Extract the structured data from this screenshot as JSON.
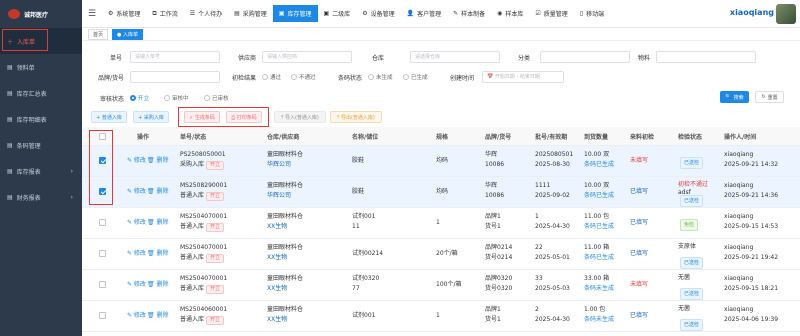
{
  "brand": {
    "name": "诚邦医疗"
  },
  "sidebar": {
    "items": [
      {
        "label": "入库单",
        "icon": "plus-icon",
        "active": true
      },
      {
        "label": "领料单",
        "icon": "document-icon"
      },
      {
        "label": "库存汇总表",
        "icon": "document-icon"
      },
      {
        "label": "库存明细表",
        "icon": "document-icon"
      },
      {
        "label": "条码管理",
        "icon": "document-icon"
      },
      {
        "label": "库存报表",
        "icon": "document-icon",
        "arrow": "›"
      },
      {
        "label": "财务报表",
        "icon": "document-icon",
        "arrow": "›"
      }
    ]
  },
  "topnav": {
    "items": [
      {
        "label": "系统管理",
        "icon": "gear-icon"
      },
      {
        "label": "工作流",
        "icon": "flow-icon"
      },
      {
        "label": "个人待办",
        "icon": "list-icon"
      },
      {
        "label": "采购管理",
        "icon": "doc-icon"
      },
      {
        "label": "库存管理",
        "icon": "box-icon",
        "active": true
      },
      {
        "label": "二级库",
        "icon": "box-icon"
      },
      {
        "label": "设备管理",
        "icon": "gear-icon"
      },
      {
        "label": "客户管理",
        "icon": "user-icon"
      },
      {
        "label": "样本制备",
        "icon": "edit-icon"
      },
      {
        "label": "样本库",
        "icon": "github-icon"
      },
      {
        "label": "质量管理",
        "icon": "check-icon"
      },
      {
        "label": "移动端",
        "icon": "mobile-icon"
      }
    ],
    "user": "xiaoqiang"
  },
  "tags": {
    "home": "首页",
    "active": "入库单"
  },
  "filter": {
    "labels": {
      "code": "单号",
      "supplier": "供应商",
      "warehouse": "仓库",
      "category": "分类",
      "material": "物料",
      "brand": "品牌/货号",
      "inspect": "初检结果",
      "barcode": "条码状态",
      "created": "创建时间",
      "audit": "审核状态"
    },
    "placeholders": {
      "code": "请输入单号",
      "supplier": "请输入供应商",
      "warehouse": "请选择仓库",
      "created_start": "开始日期",
      "created_end": "结束日期",
      "range_sep": "-"
    },
    "inspect_opts": [
      "通过",
      "不通过"
    ],
    "barcode_opts": [
      "未生成",
      "已生成"
    ],
    "audit_opts": [
      "开立",
      "审核中",
      "已审核"
    ]
  },
  "toolbar": {
    "new": "+ 普通入库",
    "purchase": "+ 采购入库",
    "gen": "✓ 生成条码",
    "print": "⎙ 打印条码",
    "import": "⤒ 导入(普通入库)",
    "import2": "⤒ 导出(普通入库)",
    "search": "搜索",
    "reset": "重置"
  },
  "table": {
    "headers": [
      "操作",
      "单号/状态",
      "仓库/供应商",
      "名称/储位",
      "规格",
      "品牌/货号",
      "批号/有效期",
      "到货数量",
      "来料初检",
      "检验状态",
      "操作人/时间"
    ],
    "actions": {
      "edit": "✎ 修改",
      "del": "🗑 删除"
    },
    "rows": [
      {
        "checked": true,
        "no": "PS2508050001",
        "type": "采购入库",
        "status": "开立",
        "wh": "童田眼材料仓",
        "sup": "华辉公司",
        "name": "胶鞋",
        "loc": "",
        "spec": "均码",
        "brand": "华辉",
        "code": "10086",
        "lot": "2025080501",
        "exp": "2025-08-30",
        "qty": "10.00 双",
        "bar": "条码已生成",
        "insp": "未填写",
        "insp_red": true,
        "check": "已送检",
        "check_green": false,
        "op": "xiaoqiang",
        "time": "2025-09-21 14:32"
      },
      {
        "checked": true,
        "no": "MS2508290001",
        "type": "普通入库",
        "status": "开立",
        "wh": "童田眼材料仓",
        "sup": "华辉公司",
        "name": "胶鞋",
        "loc": "",
        "spec": "均码",
        "brand": "华辉",
        "code": "10086",
        "lot": "1111",
        "exp": "2025-09-02",
        "qty": "10.00 双",
        "bar": "条码已生成",
        "insp": "已填写",
        "insp_red": false,
        "check": "已送检",
        "check_green": false,
        "check_pre": "初检不通过",
        "check_note": "adsf",
        "op": "xiaoqiang",
        "time": "2025-09-21 14:36"
      },
      {
        "checked": false,
        "no": "MS2504070001",
        "type": "普通入库",
        "status": "开立",
        "wh": "童田眼材料仓",
        "sup": "XX生物",
        "name": "试剂001",
        "loc": "11",
        "spec": "1",
        "brand": "品牌1",
        "code": "货号1",
        "lot": "1",
        "exp": "2025-04-30",
        "qty": "11.00 包",
        "bar": "条码已生成",
        "insp": "已填写",
        "insp_red": false,
        "check": "免检",
        "check_green": true,
        "op": "xiaoqiang",
        "time": "2025-09-15 14:53"
      },
      {
        "checked": false,
        "no": "MS2504070001",
        "type": "普通入库",
        "status": "开立",
        "wh": "童田眼材料仓",
        "sup": "XX生物",
        "name": "试剂00214",
        "loc": "",
        "spec": "20个/箱",
        "brand": "品牌0214",
        "code": "货号0214",
        "lot": "22",
        "exp": "2025-05-01",
        "qty": "11.00 箱",
        "bar": "条码已生成",
        "insp": "已填写",
        "insp_red": false,
        "check": "已送检",
        "check_green": false,
        "check_pre": "支原体",
        "op": "xiaoqiang",
        "time": "2025-09-21 19:42"
      },
      {
        "checked": false,
        "no": "MS2504070001",
        "type": "普通入库",
        "status": "开立",
        "wh": "童田眼材料仓",
        "sup": "XX生物",
        "name": "试剂0320",
        "loc": "77",
        "spec": "100个/箱",
        "brand": "品牌0320",
        "code": "货号0320",
        "lot": "33",
        "exp": "2025-05-03",
        "qty": "33.00 箱",
        "bar": "条码未生成",
        "insp": "未填写",
        "insp_red": true,
        "check": "已送检",
        "check_green": false,
        "check_pre": "无菌",
        "op": "xiaoqiang",
        "time": "2025-09-15 18:21"
      },
      {
        "checked": false,
        "no": "MS2504060001",
        "type": "普通入库",
        "status": "开立",
        "wh": "童田眼材料仓",
        "sup": "XX生物",
        "name": "试剂001",
        "loc": "",
        "spec": "1",
        "brand": "品牌1",
        "code": "货号1",
        "lot": "2",
        "exp": "2025-04-30",
        "qty": "1.00 包",
        "bar": "条码未生成",
        "insp": "已填写",
        "insp_red": false,
        "check": "已送检",
        "check_green": false,
        "check_pre": "无菌",
        "op": "xiaoqiang",
        "time": "2025-04-06 19:39"
      }
    ]
  },
  "colors": {
    "accent": "#1e88e5",
    "sidebar": "#2d3a4b",
    "danger": "#e53935"
  }
}
